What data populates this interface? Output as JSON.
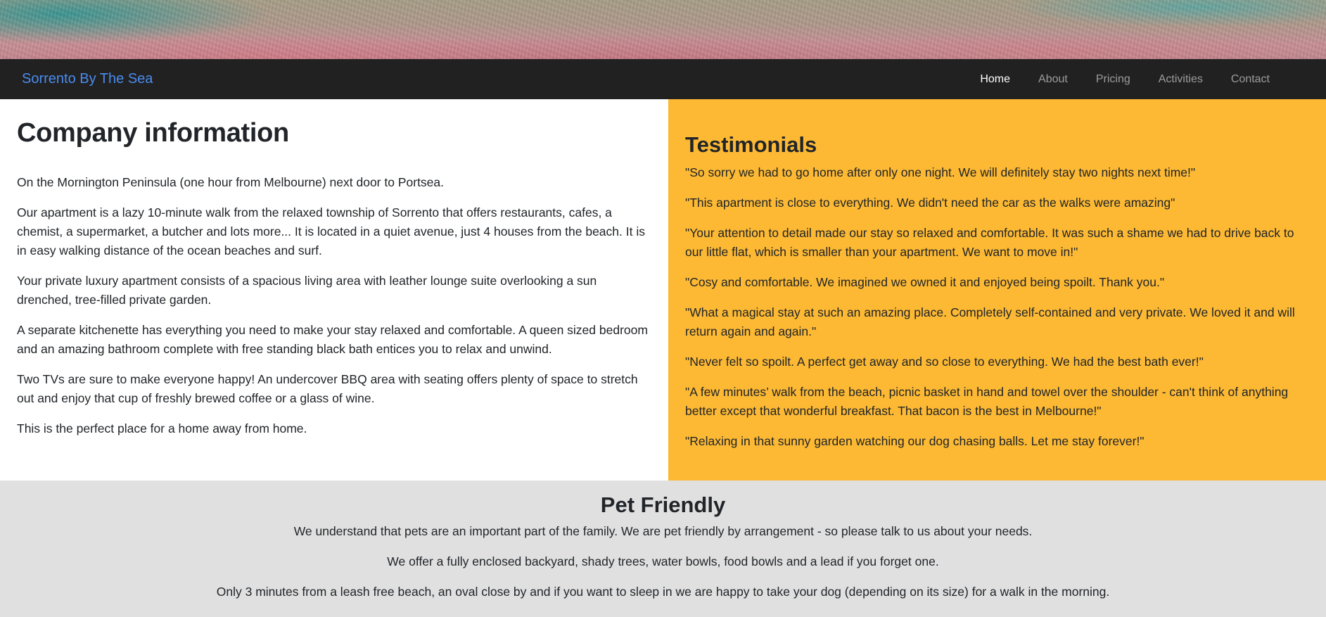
{
  "navbar": {
    "brand": "Sorrento By The Sea",
    "links": [
      {
        "label": "Home",
        "active": true
      },
      {
        "label": "About",
        "active": false
      },
      {
        "label": "Pricing",
        "active": false
      },
      {
        "label": "Activities",
        "active": false
      },
      {
        "label": "Contact",
        "active": false
      }
    ]
  },
  "company": {
    "title": "Company information",
    "paragraphs": [
      "On the Mornington Peninsula (one hour from Melbourne) next door to Portsea.",
      "Our apartment is a lazy 10-minute walk from the relaxed township of Sorrento that offers restaurants, cafes, a chemist, a supermarket, a butcher and lots more... It is located in a quiet avenue, just 4 houses from the beach. It is in easy walking distance of the ocean beaches and surf.",
      "Your private luxury apartment consists of a spacious living area with leather lounge suite overlooking a sun drenched, tree-filled private garden.",
      "A separate kitchenette has everything you need to make your stay relaxed and comfortable. A queen sized bedroom and an amazing bathroom complete with free standing black bath entices you to relax and unwind.",
      "Two TVs are sure to make everyone happy! An undercover BBQ area with seating offers plenty of space to stretch out and enjoy that cup of freshly brewed coffee or a glass of wine.",
      "This is the perfect place for a home away from home."
    ]
  },
  "testimonials": {
    "title": "Testimonials",
    "items": [
      "\"So sorry we had to go home after only one night. We will definitely stay two nights next time!\"",
      "\"This apartment is close to everything. We didn't need the car as the walks were amazing\"",
      "\"Your attention to detail made our stay so relaxed and comfortable. It was such a shame we had to drive back to our little flat, which is smaller than your apartment. We want to move in!\"",
      "\"Cosy and comfortable. We imagined we owned it and enjoyed being spoilt. Thank you.\"",
      "\"What a magical stay at such an amazing place. Completely self-contained and very private. We loved it and will return again and again.\"",
      "\"Never felt so spoilt. A perfect get away and so close to everything. We had the best bath ever!\"",
      "\"A few minutes’ walk from the beach, picnic basket in hand and towel over the shoulder - can't think of anything better except that wonderful breakfast. That bacon is the best in Melbourne!\"",
      "\"Relaxing in that sunny garden watching our dog chasing balls. Let me stay forever!\""
    ]
  },
  "pet": {
    "title": "Pet Friendly",
    "paragraphs": [
      "We understand that pets are an important part of the family. We are pet friendly by arrangement - so please talk to us about your needs.",
      "We offer a fully enclosed backyard, shady trees, water bowls, food bowls and a lead if you forget one.",
      "Only 3 minutes from a leash free beach, an oval close by and if you want to sleep in we are happy to take your dog (depending on its size) for a walk in the morning."
    ]
  },
  "colors": {
    "navbar_bg": "#212121",
    "brand": "#4a8cf0",
    "testimonials_bg": "#fdb933",
    "pet_bg": "#e0e0e0"
  }
}
